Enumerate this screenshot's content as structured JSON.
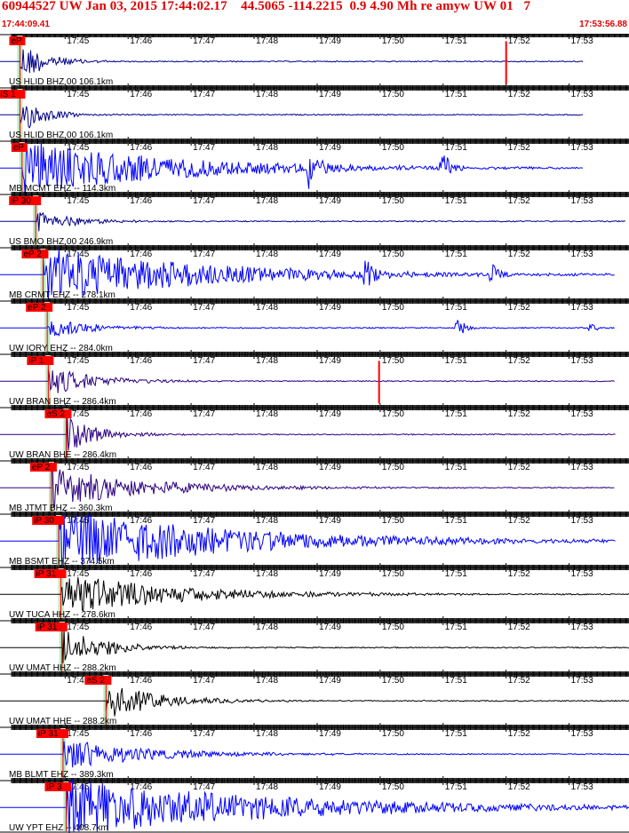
{
  "header": {
    "title": "60944527 UW Jan 03, 2015 17:44:02.17    44.5065 -114.2215  0.9 4.90 Mh re amyw UW 01   7",
    "start_time": "17:44:09.41",
    "end_time": "17:53:56.88"
  },
  "colors": {
    "header": "#e00000",
    "pick": "#ff0000",
    "window": "#bfe7bf",
    "tick": "#000000"
  },
  "chart_data": {
    "type": "line",
    "title": "",
    "time_ticks": [
      "17:45",
      "17:46",
      "17:47",
      "17:48",
      "17:49",
      "17:50",
      "17:51",
      "17:52",
      "17:53"
    ],
    "first_tick_offset_s": 51,
    "total_seconds": 588,
    "traces": [
      {
        "label": "US HLID BHZ 00 106.1km",
        "color": "#00008b",
        "pick": "eP",
        "onset_s": 8,
        "amp": 0.8,
        "decay": 25,
        "events": [
          {
            "t": 471,
            "a": 1.0,
            "red": true
          }
        ],
        "ends_s": 545
      },
      {
        "label": "US HLID BHZ 00 106.1km",
        "color": "#00008b",
        "pick": "iS 1",
        "onset_s": 8,
        "amp": 0.75,
        "decay": 22,
        "events": [],
        "ends_s": 545
      },
      {
        "label": "MB MCMT EHZ -- 114.3km",
        "color": "#0000ff",
        "pick": "eP",
        "onset_s": 10,
        "amp": 1.1,
        "decay": 140,
        "events": [
          {
            "t": 285,
            "a": 0.9
          },
          {
            "t": 410,
            "a": 1.0
          }
        ],
        "ends_s": 545
      },
      {
        "label": "US BMO BHZ 00 246.9km",
        "color": "#00008b",
        "pick": "iP 30",
        "onset_s": 23,
        "amp": 0.45,
        "decay": 35,
        "events": [],
        "ends_s": 585
      },
      {
        "label": "MB CRMT EHZ -- 278.1km",
        "color": "#0000ff",
        "pick": "eP 2",
        "onset_s": 30,
        "amp": 1.1,
        "decay": 150,
        "events": [
          {
            "t": 338,
            "a": 0.5
          },
          {
            "t": 458,
            "a": 0.35
          }
        ],
        "ends_s": 575
      },
      {
        "label": "UW IORY EHZ -- 284.0km",
        "color": "#0000ff",
        "pick": "eP 2",
        "onset_s": 34,
        "amp": 0.4,
        "decay": 40,
        "events": [
          {
            "t": 425,
            "a": 0.6
          },
          {
            "t": 552,
            "a": 0.2
          }
        ],
        "ends_s": 575
      },
      {
        "label": "UW BRAN BHZ -- 286.4km",
        "color": "#2b0080",
        "pick": "iP 1",
        "onset_s": 35,
        "amp": 0.55,
        "decay": 45,
        "events": [
          {
            "t": 350,
            "a": 1.0,
            "red": true
          }
        ],
        "ends_s": 575
      },
      {
        "label": "UW BRAN BHE -- 286.4km",
        "color": "#2b0080",
        "pick": "eS 2",
        "onset_s": 52,
        "amp": 0.7,
        "decay": 30,
        "events": [],
        "ends_s": 575
      },
      {
        "label": "MB JTMT BHZ -- 360.3km",
        "color": "#2b0080",
        "pick": "eP 2",
        "onset_s": 38,
        "amp": 0.75,
        "decay": 90,
        "events": [],
        "ends_s": 575
      },
      {
        "label": "MB BSMT EHZ -- 374.5km",
        "color": "#0000ff",
        "pick": "iP 30",
        "onset_s": 45,
        "amp": 1.2,
        "decay": 170,
        "events": [],
        "ends_s": 575
      },
      {
        "label": "UW TUCA HHZ -- 278.6km",
        "color": "#000000",
        "pick": "iP 31",
        "onset_s": 47,
        "amp": 0.8,
        "decay": 110,
        "events": [],
        "ends_s": 590
      },
      {
        "label": "UW UMAT HHZ -- 288.2km",
        "color": "#000000",
        "pick": "iP 31",
        "onset_s": 48,
        "amp": 0.7,
        "decay": 45,
        "events": [],
        "ends_s": 590
      },
      {
        "label": "UW UMAT HHE -- 288.2km",
        "color": "#000000",
        "pick": "eS 2",
        "onset_s": 90,
        "amp": 0.7,
        "decay": 50,
        "events": [],
        "ends_s": 590
      },
      {
        "label": "MB BLMT EHZ -- 389.3km",
        "color": "#0000ff",
        "pick": "iP 31",
        "onset_s": 49,
        "amp": 0.6,
        "decay": 80,
        "events": [],
        "ends_s": 590
      },
      {
        "label": "UW YPT EHZ -- 408.7km",
        "color": "#0000ff",
        "pick": "iP 3",
        "onset_s": 52,
        "amp": 1.1,
        "decay": 200,
        "events": [],
        "ends_s": 590
      }
    ]
  }
}
